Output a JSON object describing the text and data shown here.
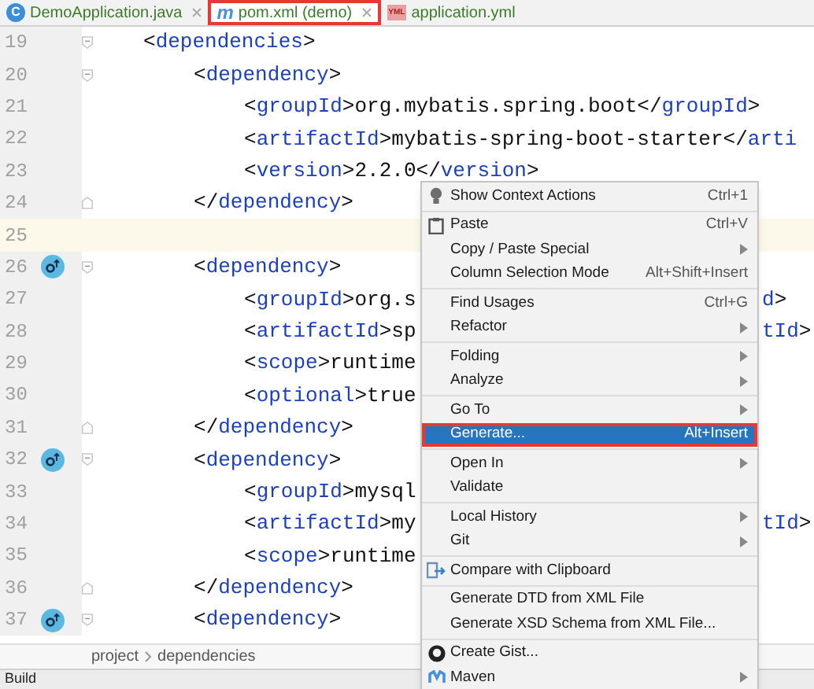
{
  "tabs": [
    {
      "label": "DemoApplication.java",
      "kind": "java",
      "icon_label": "C",
      "selected": false,
      "closable": true
    },
    {
      "label": "pom.xml (demo)",
      "kind": "maven",
      "icon_label": "m",
      "selected": true,
      "closable": true
    },
    {
      "label": "application.yml",
      "kind": "yml",
      "icon_label": "YML",
      "selected": false,
      "closable": false
    }
  ],
  "editor": {
    "lines": [
      {
        "number": "19",
        "text": "<dependencies>",
        "kind": "open",
        "gutter_icon": false,
        "current": false,
        "children": [
          {
            "number": "20",
            "text": "<dependency>",
            "kind": "open",
            "gutter_icon": false,
            "current": false,
            "children": [
              {
                "number": "21",
                "text": "<groupId>org.mybatis.spring.boot</groupId>",
                "gutter_icon": false,
                "current": false
              },
              {
                "number": "22",
                "text": "<artifactId>mybatis-spring-boot-starter</arti",
                "gutter_icon": false,
                "current": false
              },
              {
                "number": "23",
                "text": "<version>2.2.0</version>",
                "gutter_icon": false,
                "current": false
              }
            ]
          },
          {
            "number": "24",
            "text": "</dependency>",
            "kind": "close",
            "gutter_icon": false,
            "current": false
          },
          {
            "number": "25",
            "gutter_icon": false,
            "current": true
          },
          {
            "number": "26",
            "text": "<dependency>",
            "kind": "open",
            "gutter_icon": true,
            "current": false,
            "children": [
              {
                "number": "27",
                "text": "<groupId>org.s",
                "tail": "d>",
                "gutter_icon": false,
                "current": false
              },
              {
                "number": "28",
                "text": "<artifactId>sp",
                "tail": "tId>",
                "gutter_icon": false,
                "current": false
              },
              {
                "number": "29",
                "text": "<scope>runtime",
                "gutter_icon": false,
                "current": false
              },
              {
                "number": "30",
                "text": "<optional>true",
                "gutter_icon": false,
                "current": false
              }
            ]
          },
          {
            "number": "31",
            "text": "</dependency>",
            "kind": "close",
            "gutter_icon": false,
            "current": false
          },
          {
            "number": "32",
            "text": "<dependency>",
            "kind": "open",
            "gutter_icon": true,
            "current": false,
            "children": [
              {
                "number": "33",
                "text": "<groupId>mysql",
                "gutter_icon": false,
                "current": false
              },
              {
                "number": "34",
                "text": "<artifactId>my",
                "tail": "tId>",
                "gutter_icon": false,
                "current": false
              },
              {
                "number": "35",
                "text": "<scope>runtime",
                "gutter_icon": false,
                "current": false
              }
            ]
          },
          {
            "number": "36",
            "text": "</dependency>",
            "kind": "close",
            "gutter_icon": false,
            "current": false
          },
          {
            "number": "37",
            "text": "<dependency>",
            "kind": "open",
            "gutter_icon": true,
            "current": false
          }
        ]
      }
    ]
  },
  "breadcrumbs": [
    "project",
    "dependencies"
  ],
  "bottom_bar": {
    "label": "Build"
  },
  "context_menu": {
    "groups": [
      [
        {
          "label": "Show Context Actions",
          "shortcut": "Ctrl+1",
          "submenu": false,
          "selected": false
        }
      ],
      [
        {
          "label": "Paste",
          "shortcut": "Ctrl+V",
          "submenu": false,
          "selected": false
        },
        {
          "label": "Copy / Paste Special",
          "submenu": true,
          "selected": false
        },
        {
          "label": "Column Selection Mode",
          "shortcut": "Alt+Shift+Insert",
          "submenu": false,
          "selected": false
        }
      ],
      [
        {
          "label": "Find Usages",
          "shortcut": "Ctrl+G",
          "submenu": false,
          "selected": false
        },
        {
          "label": "Refactor",
          "submenu": true,
          "selected": false
        }
      ],
      [
        {
          "label": "Folding",
          "submenu": true,
          "selected": false
        },
        {
          "label": "Analyze",
          "submenu": true,
          "selected": false
        }
      ],
      [
        {
          "label": "Go To",
          "submenu": true,
          "selected": false
        },
        {
          "label": "Generate...",
          "shortcut": "Alt+Insert",
          "submenu": false,
          "selected": true
        }
      ],
      [
        {
          "label": "Open In",
          "submenu": true,
          "selected": false
        },
        {
          "label": "Validate",
          "submenu": false,
          "selected": false
        }
      ],
      [
        {
          "label": "Local History",
          "submenu": true,
          "selected": false
        },
        {
          "label": "Git",
          "submenu": true,
          "selected": false
        }
      ],
      [
        {
          "label": "Compare with Clipboard",
          "submenu": false,
          "selected": false
        }
      ],
      [
        {
          "label": "Generate DTD from XML File",
          "submenu": false,
          "selected": false
        },
        {
          "label": "Generate XSD Schema from XML File...",
          "submenu": false,
          "selected": false
        }
      ],
      [
        {
          "label": "Create Gist...",
          "submenu": false,
          "selected": false
        },
        {
          "label": "Maven",
          "submenu": true,
          "selected": false
        }
      ]
    ]
  }
}
